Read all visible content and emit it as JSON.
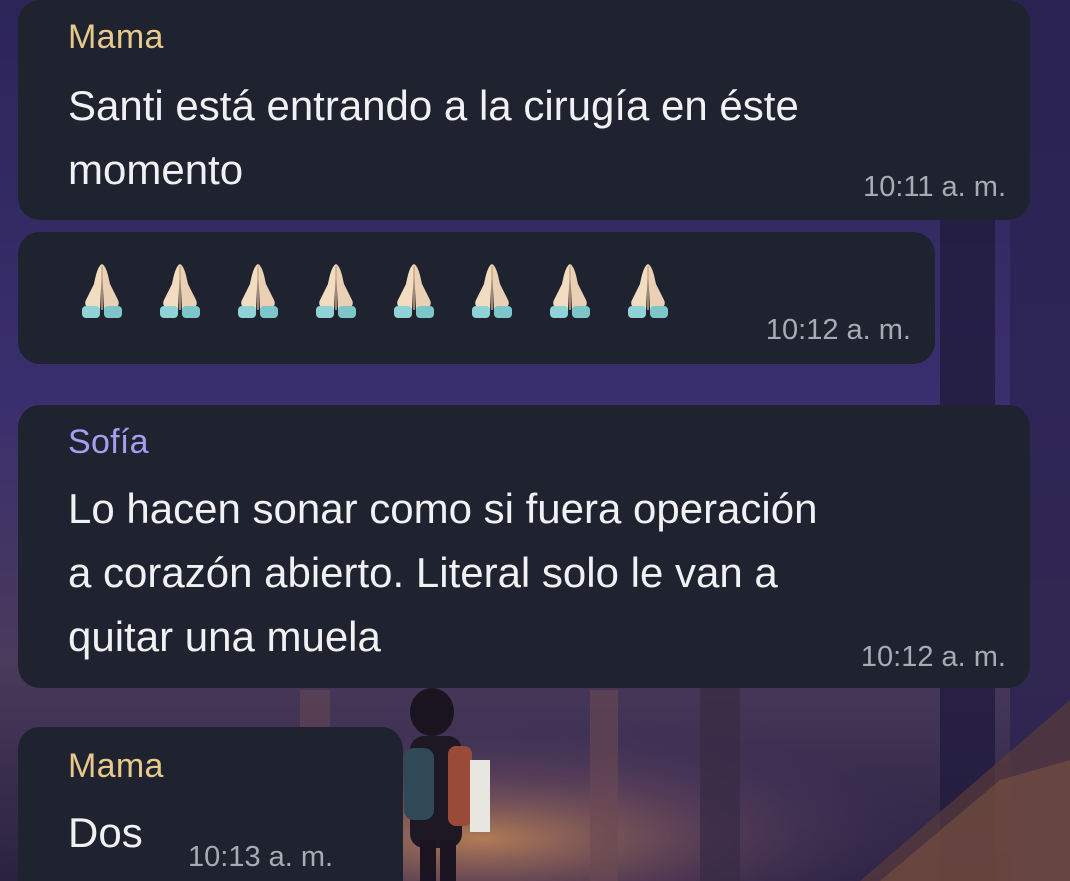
{
  "colors": {
    "bubble": "#1f2330",
    "sender_mama": "#e8c98c",
    "sender_sofia": "#a79df0",
    "message_text": "#f1f1f3",
    "timestamp": "#a7abb3",
    "wallpaper": "#2a2550"
  },
  "messages": [
    {
      "sender": "Mama",
      "lines": [
        "Santi está entrando a la cirugía en éste",
        "momento"
      ],
      "time": "10:11 a. m."
    },
    {
      "emoji": "folded-hands",
      "emoji_count": 8,
      "time": "10:12 a. m."
    },
    {
      "sender": "Sofía",
      "lines": [
        "Lo hacen sonar como si fuera operación",
        "a corazón abierto. Literal solo le van a",
        "quitar una muela"
      ],
      "time": "10:12 a. m."
    },
    {
      "sender": "Mama",
      "lines": [
        "Dos"
      ],
      "time": "10:13 a. m."
    }
  ]
}
